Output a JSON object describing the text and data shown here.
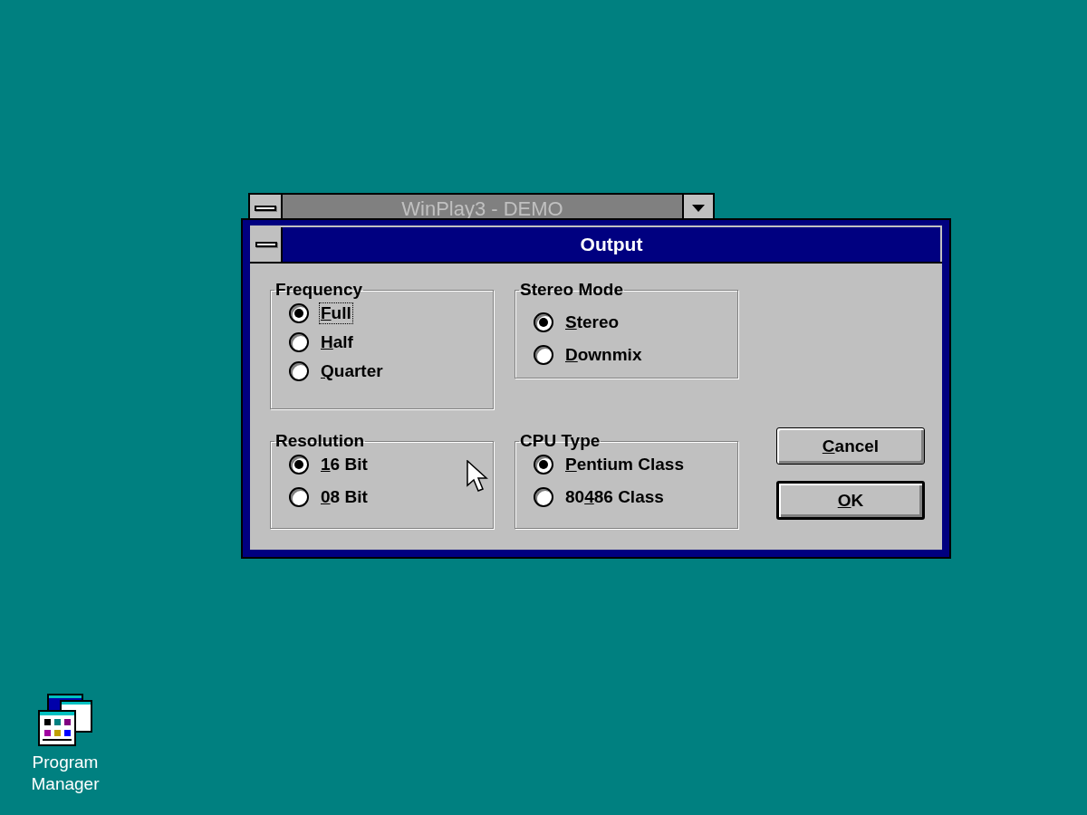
{
  "background_window": {
    "title": "WinPlay3 - DEMO"
  },
  "dialog": {
    "title": "Output",
    "groups": [
      {
        "title": "Frequency",
        "options": [
          {
            "key": "F",
            "post": "ull",
            "selected": true,
            "focused": true
          },
          {
            "key": "H",
            "post": "alf",
            "selected": false,
            "focused": false
          },
          {
            "key": "Q",
            "post": "uarter",
            "selected": false,
            "focused": false
          }
        ]
      },
      {
        "title": "Stereo Mode",
        "options": [
          {
            "key": "S",
            "post": "tereo",
            "selected": true,
            "focused": false
          },
          {
            "key": "D",
            "post": "ownmix",
            "selected": false,
            "focused": false
          }
        ]
      },
      {
        "title": "Resolution",
        "options": [
          {
            "key": "1",
            "post": "6 Bit",
            "selected": true,
            "focused": false
          },
          {
            "key": "0",
            "post": "8 Bit",
            "selected": false,
            "focused": false
          }
        ]
      },
      {
        "title": "CPU Type",
        "options": [
          {
            "key": "P",
            "post": "entium Class",
            "selected": true,
            "focused": false
          },
          {
            "pre": "80",
            "key": "4",
            "post": "86 Class",
            "selected": false,
            "focused": false
          }
        ]
      }
    ],
    "buttons": [
      {
        "key": "C",
        "post": "ancel",
        "default": false
      },
      {
        "key": "O",
        "post": "K",
        "default": true
      }
    ]
  },
  "desktop_icons": [
    {
      "label": "Program Manager"
    }
  ]
}
